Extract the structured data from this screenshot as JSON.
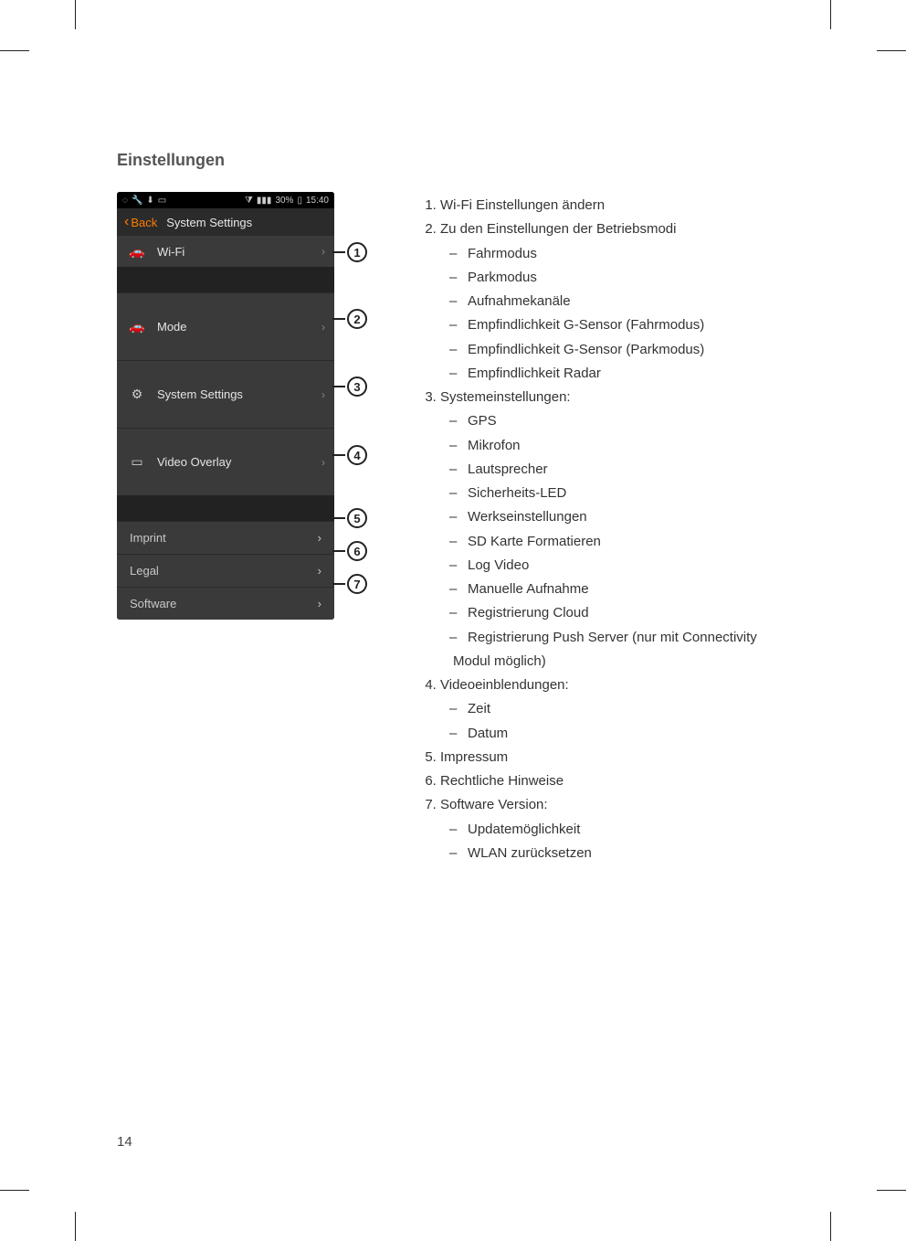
{
  "section_title": "Einstellungen",
  "page_number": "14",
  "phone": {
    "status_time": "15:40",
    "status_battery": "30%",
    "navbar_back": "Back",
    "navbar_title": "System Settings",
    "rows": {
      "wifi": "Wi-Fi",
      "mode": "Mode",
      "system_settings": "System Settings",
      "video_overlay": "Video Overlay",
      "imprint": "Imprint",
      "legal": "Legal",
      "software": "Software"
    }
  },
  "callouts": {
    "c1": "1",
    "c2": "2",
    "c3": "3",
    "c4": "4",
    "c5": "5",
    "c6": "6",
    "c7": "7"
  },
  "list": {
    "item1": "Wi-Fi Einstellungen ändern",
    "item2": "Zu den Einstellungen der Betriebsmodi",
    "item2_sub": [
      "Fahrmodus",
      "Parkmodus",
      "Aufnahmekanäle",
      "Empfindlichkeit G-Sensor (Fahrmodus)",
      "Empfindlichkeit G-Sensor (Parkmodus)",
      "Empfindlichkeit Radar"
    ],
    "item3": "Systemeinstellungen:",
    "item3_sub": [
      "GPS",
      "Mikrofon",
      "Lautsprecher",
      "Sicherheits-LED",
      "Werkseinstellungen",
      "SD Karte Formatieren",
      "Log Video",
      "Manuelle Aufnahme",
      "Registrierung Cloud",
      "Registrierung Push Server (nur mit Connectivity Modul möglich)"
    ],
    "item4": "Videoeinblendungen:",
    "item4_sub": [
      "Zeit",
      "Datum"
    ],
    "item5": "Impressum",
    "item6": "Rechtliche Hinweise",
    "item7": "Software Version:",
    "item7_sub": [
      "Updatemöglichkeit",
      "WLAN zurücksetzen"
    ]
  }
}
